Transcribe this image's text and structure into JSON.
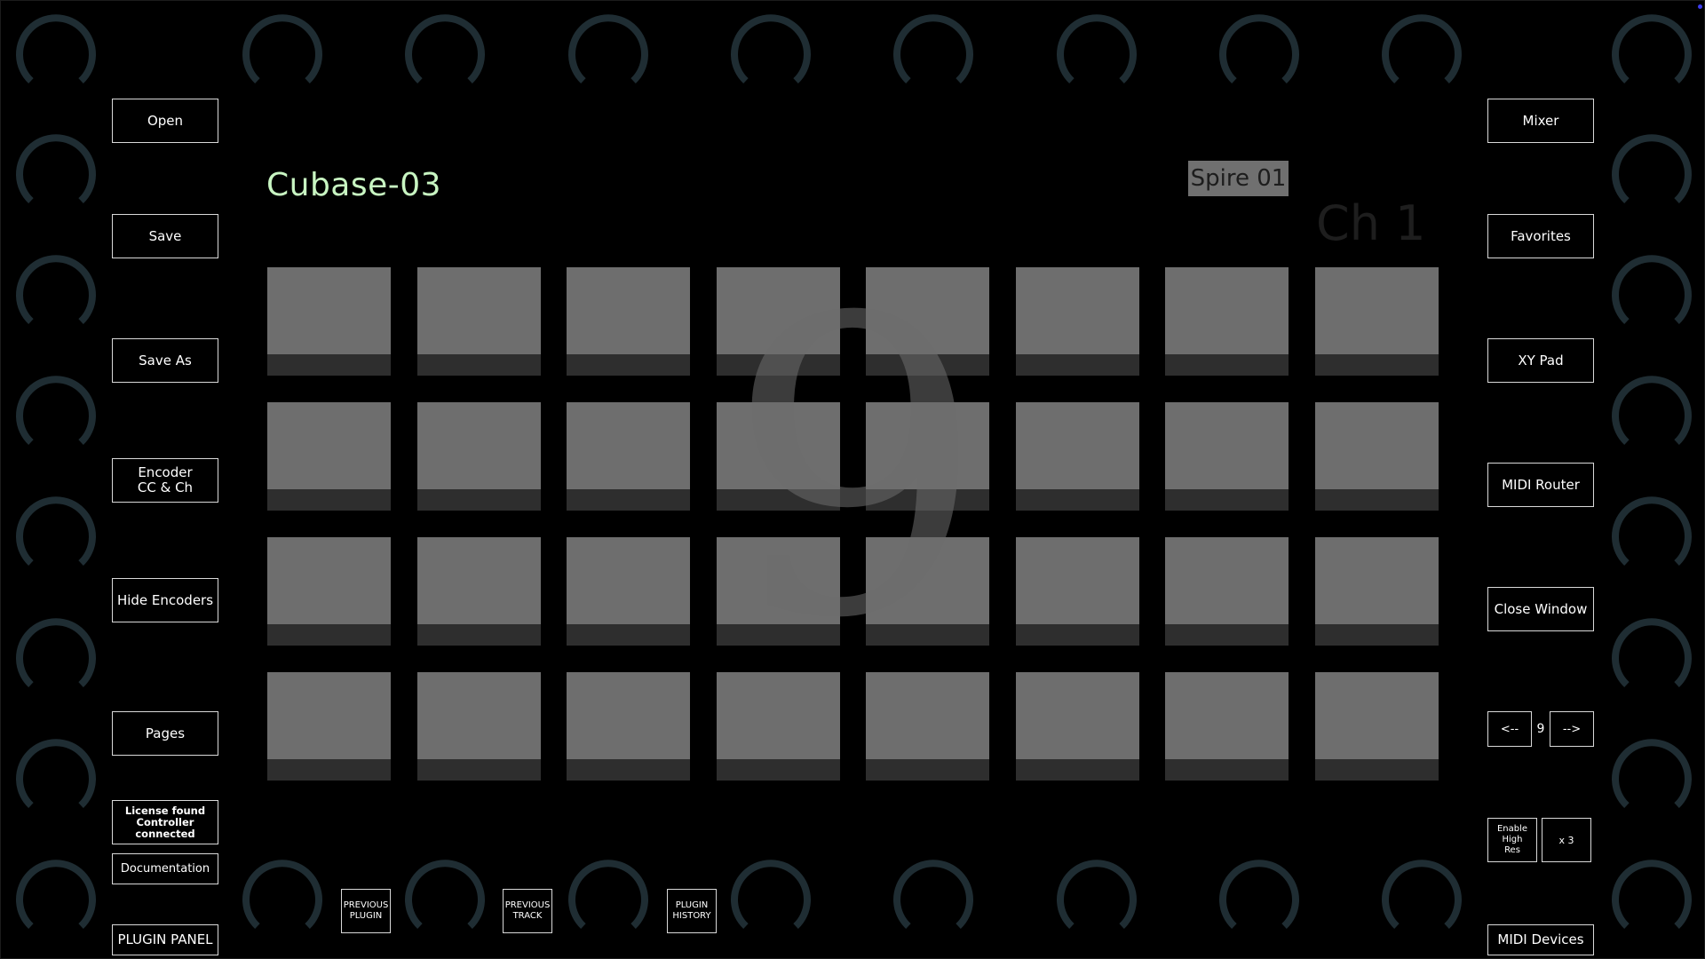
{
  "header": {
    "title": "Cubase-03",
    "plugin_name": "Spire 01",
    "channel": "Ch 1",
    "page_watermark": "9"
  },
  "left_buttons": {
    "open": "Open",
    "save": "Save",
    "save_as": "Save As",
    "encoder_cc": "Encoder\nCC & Ch",
    "hide_encoders": "Hide Encoders",
    "pages": "Pages",
    "license_status": "License found\nController\nconnected",
    "documentation": "Documentation",
    "plugin_panel": "PLUGIN PANEL"
  },
  "right_buttons": {
    "mixer": "Mixer",
    "favorites": "Favorites",
    "xy_pad": "XY Pad",
    "midi_router": "MIDI Router",
    "close_window": "Close Window",
    "prev_page": "<--",
    "page_number": "9",
    "next_page": "-->",
    "enable_high_res": "Enable\nHigh\nRes",
    "multiplier": "x 3",
    "midi_devices": "MIDI Devices"
  },
  "bottom_buttons": {
    "previous_plugin": "PREVIOUS\nPLUGIN",
    "previous_track": "PREVIOUS\nTRACK",
    "plugin_history": "PLUGIN\nHISTORY"
  },
  "pads": {
    "rows": 4,
    "columns": 8
  },
  "colors": {
    "background": "#000000",
    "title": "#c8f5c2",
    "pad": "#6e6e6e",
    "pad_strip": "#2e2e2e",
    "knob": "#1f2d33",
    "button_border": "#d9d9d9"
  }
}
